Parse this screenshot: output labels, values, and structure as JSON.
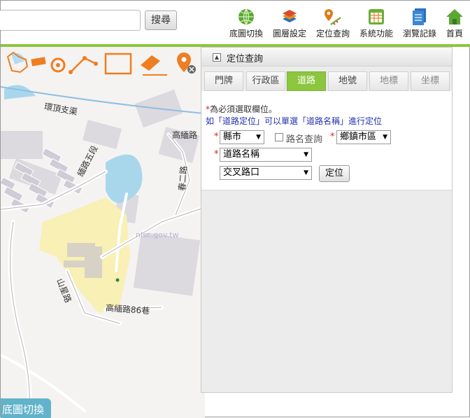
{
  "header": {
    "search_placeholder": "",
    "search_button": "搜尋",
    "nav": [
      {
        "label": "底圖切換",
        "icon": "globe-icon"
      },
      {
        "label": "圖層設定",
        "icon": "layers-icon"
      },
      {
        "label": "定位查詢",
        "icon": "locate-query-icon"
      },
      {
        "label": "系統功能",
        "icon": "calendar-grid-icon"
      },
      {
        "label": "瀏覽記錄",
        "icon": "document-icon"
      },
      {
        "label": "首頁",
        "icon": "home-icon"
      }
    ],
    "accent_color": "#8cc63f"
  },
  "map": {
    "labels": {
      "canal": "環頂支渠",
      "road_gaomin": "高緬路",
      "road_vertical": "緬路五段",
      "road_alley": "高緬路86巷",
      "road_left": "春二路",
      "road_bottom": "山星路",
      "watermark": "nlsc.gov.tw"
    },
    "tools": [
      "hand-pan-icon",
      "measure-ruler-icon",
      "circle-draw-icon",
      "polyline-draw-icon",
      "rectangle-draw-icon",
      "eraser-icon",
      "remove-location-pin-icon"
    ],
    "basemap_tab": "底圖切換"
  },
  "panel": {
    "title": "定位查詢",
    "tabs": [
      "門牌",
      "行政區",
      "道路",
      "地號",
      "地標",
      "坐標"
    ],
    "active_tab": "道路",
    "required_note": "為必須選取欄位。",
    "hint": "如「道路定位」可以單選「道路名稱」進行定位",
    "county_select": "縣市",
    "road_name_check_label": "路名查詢",
    "town_select": "鄉鎮市區",
    "road_select": "道路名稱",
    "intersection_select": "交叉路口",
    "locate_button": "定位"
  }
}
